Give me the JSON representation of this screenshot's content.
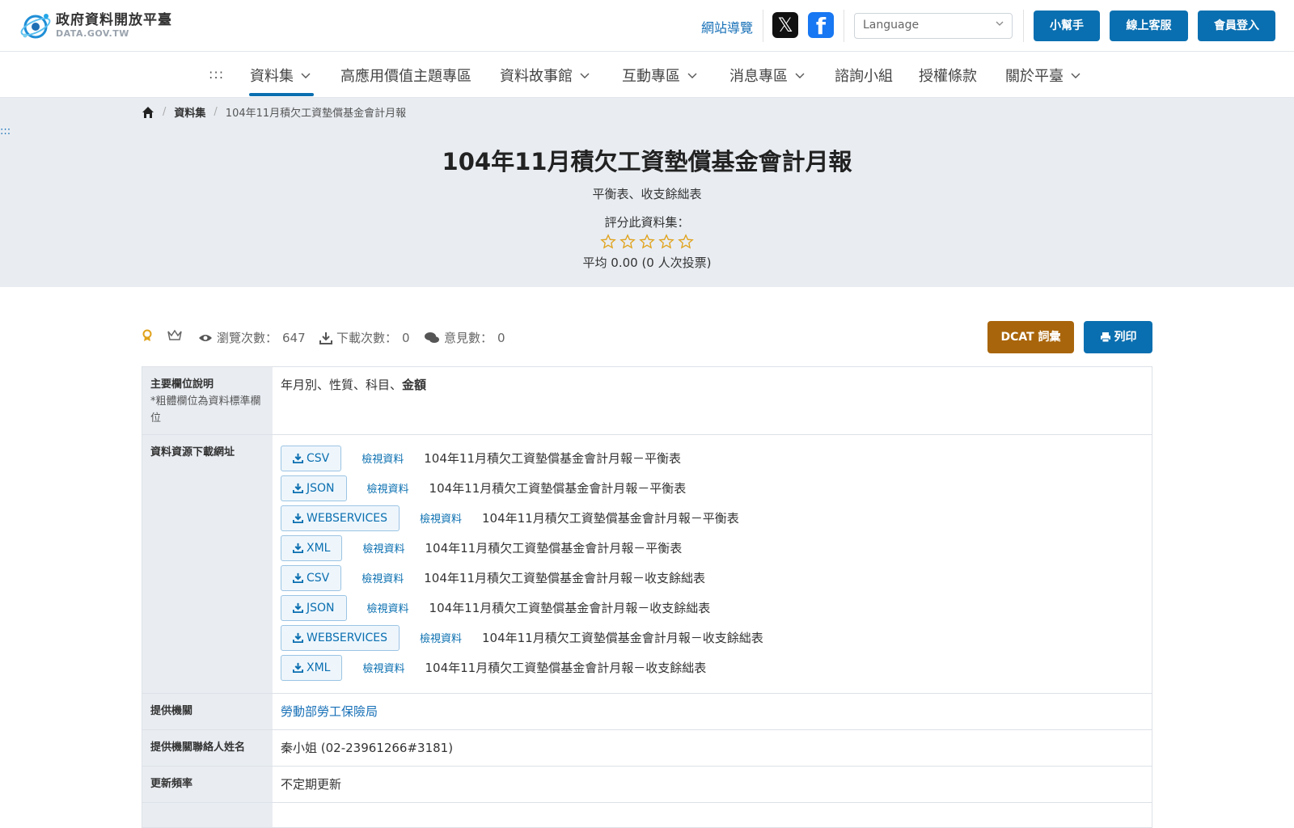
{
  "header": {
    "logo_title": "政府資料開放平臺",
    "logo_sub": "DATA.GOV.TW",
    "sitemap": "網站導覽",
    "language_placeholder": "Language",
    "buttons": {
      "helper": "小幫手",
      "service": "線上客服",
      "login": "會員登入"
    }
  },
  "nav": {
    "dots": ":::",
    "items": [
      "資料集",
      "高應用價值主題專區",
      "資料故事館",
      "互動專區",
      "消息專區",
      "諮詢小組",
      "授權條款",
      "關於平臺"
    ]
  },
  "breadcrumb": {
    "datasets": "資料集",
    "current": "104年11月積欠工資墊償基金會計月報"
  },
  "side_dots": ":::",
  "dataset": {
    "title": "104年11月積欠工資墊償基金會計月報",
    "subtitle": "平衡表、收支餘絀表",
    "rate_label": "評分此資料集：",
    "rating_stars": 0,
    "avg_text": "平均 0.00 (0 人次投票)"
  },
  "stats": {
    "views_label": "瀏覽次數：",
    "views": "647",
    "downloads_label": "下載次數：",
    "downloads": "0",
    "comments_label": "意見數：",
    "comments": "0"
  },
  "actions": {
    "dcat": "DCAT 詞彙",
    "print": "列印"
  },
  "table": {
    "fields_header": "主要欄位說明",
    "fields_note": "*粗體欄位為資料標準欄位",
    "fields_plain": "年月別、性質、科目、",
    "fields_bold": "金額",
    "resources_header": "資料資源下載網址",
    "view_label": "檢視資料",
    "resources": [
      {
        "format": "CSV",
        "name": "104年11月積欠工資墊償基金會計月報－平衡表"
      },
      {
        "format": "JSON",
        "name": "104年11月積欠工資墊償基金會計月報－平衡表"
      },
      {
        "format": "WEBSERVICES",
        "name": "104年11月積欠工資墊償基金會計月報－平衡表"
      },
      {
        "format": "XML",
        "name": "104年11月積欠工資墊償基金會計月報－平衡表"
      },
      {
        "format": "CSV",
        "name": "104年11月積欠工資墊償基金會計月報－收支餘絀表"
      },
      {
        "format": "JSON",
        "name": "104年11月積欠工資墊償基金會計月報－收支餘絀表"
      },
      {
        "format": "WEBSERVICES",
        "name": "104年11月積欠工資墊償基金會計月報－收支餘絀表"
      },
      {
        "format": "XML",
        "name": "104年11月積欠工資墊償基金會計月報－收支餘絀表"
      }
    ],
    "provider_header": "提供機關",
    "provider": "勞動部勞工保險局",
    "contact_header": "提供機關聯絡人姓名",
    "contact": "秦小姐 (02-23961266#3181)",
    "frequency_header": "更新頻率",
    "frequency": "不定期更新"
  },
  "colors": {
    "primary": "#0a6fb0",
    "dcat": "#a9650b",
    "hero_bg": "#e9edf2",
    "star": "#e0a21b"
  }
}
